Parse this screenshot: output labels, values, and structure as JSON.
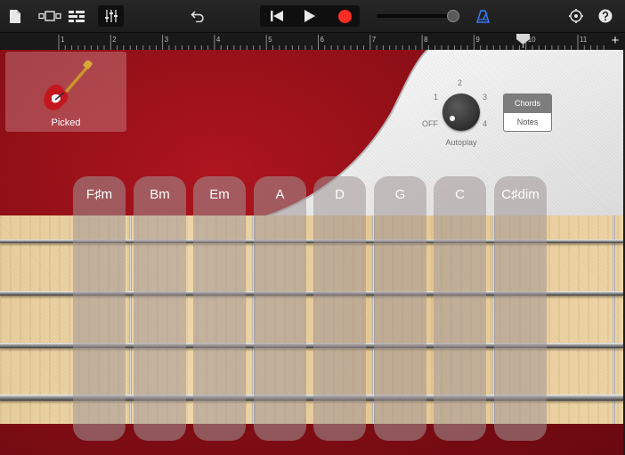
{
  "toolbar": {
    "my_songs_icon": "document-icon",
    "view_toggle_icon": "view-toggle-icon",
    "tracks_view_icon": "tracks-view-icon",
    "mixer_icon": "mixer-icon",
    "undo_icon": "undo-icon",
    "rewind_icon": "rewind-to-start-icon",
    "play_icon": "play-icon",
    "record_icon": "record-icon",
    "metronome_icon": "metronome-icon",
    "settings_icon": "settings-icon",
    "help_icon": "help-icon",
    "master_volume": 0.96,
    "record_color": "#ff2d22",
    "metronome_color": "#3a7bf5"
  },
  "ruler": {
    "bars": [
      "1",
      "2",
      "3",
      "4",
      "5",
      "6",
      "7",
      "8",
      "9",
      "10",
      "11"
    ],
    "add_section_label": "+"
  },
  "instrument": {
    "name": "Picked",
    "icon": "bass-guitar-icon"
  },
  "autoplay": {
    "label": "Autoplay",
    "positions": [
      "OFF",
      "1",
      "2",
      "3",
      "4"
    ],
    "selected": "OFF"
  },
  "mode": {
    "options": [
      "Chords",
      "Notes"
    ],
    "selected": "Chords"
  },
  "chords": [
    "F♯m",
    "Bm",
    "Em",
    "A",
    "D",
    "G",
    "C",
    "C♯dim"
  ],
  "colors": {
    "body_red": "#9a111a",
    "pickguard": "#f2f2f2",
    "neck_wood": "#ecd3a3"
  }
}
